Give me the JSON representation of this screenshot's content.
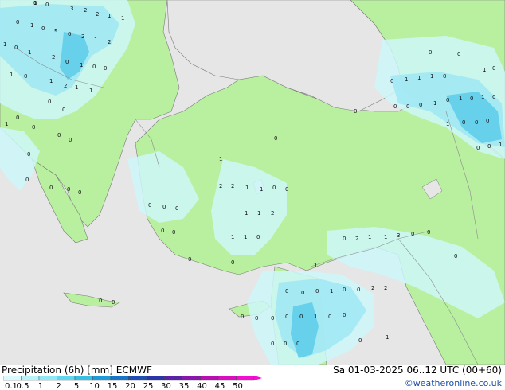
{
  "header": {
    "title": "Precipitation (6h) [mm] ECMWF",
    "validity": "Sa 01-03-2025 06..12 UTC (00+60)",
    "credit": "©weatheronline.co.uk"
  },
  "legend": {
    "tick_labels": [
      "0.1",
      "0.5",
      "1",
      "2",
      "5",
      "10",
      "15",
      "20",
      "25",
      "30",
      "35",
      "40",
      "45",
      "50"
    ],
    "colors": [
      "#d9fbff",
      "#b6f3fb",
      "#8ee8f7",
      "#5fd6f0",
      "#37bfe6",
      "#1e9bd8",
      "#1a74c8",
      "#1e4fb4",
      "#2a35a8",
      "#5a22a8",
      "#8a16ae",
      "#b80fb4",
      "#d80ec0",
      "#f20fd0"
    ]
  },
  "map": {
    "colors": {
      "sea": "#e6e6e6",
      "land": "#b9f0a0",
      "precip_light": "#cdf7f9",
      "precip_medium": "#9fe8f4",
      "precip_heavy": "#5ccbe8",
      "coast": "#7a7a7a",
      "border": "#8c8c8c"
    },
    "values": [
      "1",
      "0",
      "3",
      "2",
      "2",
      "1",
      "1",
      "0",
      "1",
      "0",
      "5",
      "0",
      "2",
      "1",
      "2",
      "1",
      "0",
      "1",
      "2",
      "0",
      "1",
      "0",
      "0",
      "1",
      "0",
      "1",
      "2",
      "1",
      "1",
      "0",
      "0",
      "0",
      "1",
      "0",
      "0",
      "0",
      "0",
      "0",
      "0",
      "0",
      "0",
      "0",
      "0",
      "0",
      "0",
      "0",
      "0",
      "1",
      "2",
      "2",
      "1",
      "1",
      "0",
      "0",
      "0",
      "1",
      "1",
      "2",
      "1",
      "1",
      "0",
      "0",
      "0",
      "0",
      "1",
      "1",
      "1",
      "0",
      "0",
      "0",
      "0",
      "1",
      "0",
      "1",
      "0",
      "1",
      "0",
      "0",
      "1",
      "0",
      "1",
      "0",
      "0",
      "0",
      "0",
      "0",
      "1",
      "0",
      "2",
      "1",
      "1",
      "3",
      "0",
      "0",
      "0",
      "0",
      "0",
      "1",
      "0",
      "0",
      "2",
      "2",
      "1",
      "0",
      "0",
      "0",
      "0",
      "0",
      "1",
      "0",
      "0",
      "0",
      "0",
      "0",
      "0",
      "1",
      "0",
      "0",
      "0",
      "0",
      "0"
    ]
  }
}
